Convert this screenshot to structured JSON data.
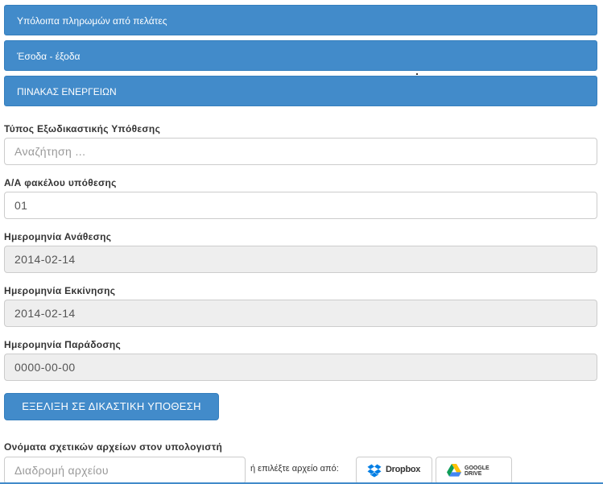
{
  "panels": [
    {
      "label": "Υπόλοιπα πληρωμών από πελάτες"
    },
    {
      "label": "Έσοδα - έξοδα"
    },
    {
      "label": "ΠΙΝΑΚΑΣ ΕΝΕΡΓΕΙΩΝ"
    }
  ],
  "form": {
    "case_type": {
      "label": "Τύπος Εξωδικαστικής Υπόθεσης",
      "placeholder": "Αναζήτηση ..."
    },
    "folder_no": {
      "label": "Α/Α φακέλου υπόθεσης",
      "value": "01"
    },
    "assign_date": {
      "label": "Ημερομηνία Ανάθεσης",
      "value": "2014-02-14"
    },
    "start_date": {
      "label": "Ημερομηνία Εκκίνησης",
      "value": "2014-02-14"
    },
    "delivery_date": {
      "label": "Ημερομηνία Παράδοσης",
      "value": "0000-00-00"
    },
    "convert_button": "ΕΞΕΛΙΞΗ ΣΕ ΔΙΚΑΣΤΙΚΗ ΥΠΟΘΕΣΗ",
    "files": {
      "label": "Ονόματα σχετικών αρχείων στον υπολογιστή",
      "placeholder": "Διαδρομή αρχείου",
      "or_text": "ή επιλέξτε αρχείο από:",
      "dropbox_label": "Dropbox",
      "gdrive_label_line1": "GOOGLE",
      "gdrive_label_line2": "DRIVE"
    }
  },
  "colors": {
    "primary": "#428bca",
    "primary_border": "#357ebd",
    "disabled_bg": "#eeeeee",
    "dropbox_blue": "#007ee5"
  },
  "icons": {
    "dropbox": "dropbox-icon",
    "gdrive": "google-drive-icon"
  }
}
